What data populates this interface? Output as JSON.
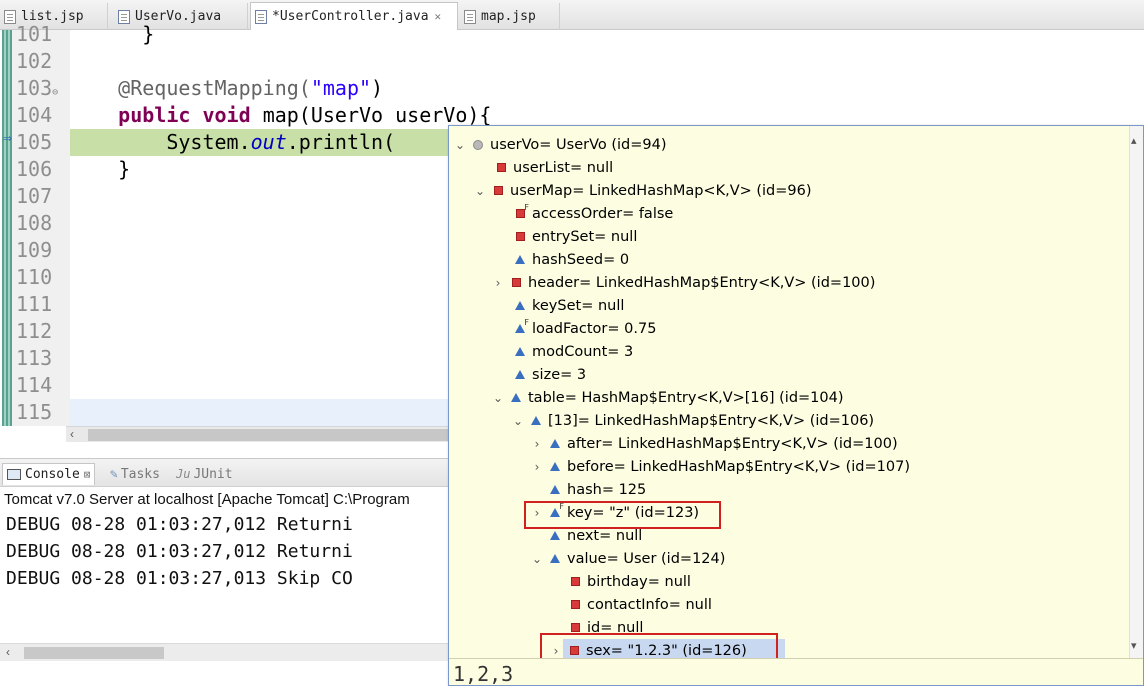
{
  "editor_tabs": [
    {
      "label": "list.jsp",
      "icon": "jsp-file-icon",
      "active": false
    },
    {
      "label": "UserVo.java",
      "icon": "java-file-icon",
      "active": false
    },
    {
      "label": "*UserController.java",
      "icon": "java-file-icon",
      "active": true,
      "close": "✕"
    },
    {
      "label": "map.jsp",
      "icon": "jsp-file-icon",
      "active": false
    }
  ],
  "editor": {
    "line_numbers": [
      "101",
      "102",
      "103",
      "104",
      "105",
      "106",
      "107",
      "108",
      "109",
      "110",
      "111",
      "112",
      "113",
      "114",
      "115"
    ],
    "code": {
      "l101": "}",
      "l103_annotation": "@RequestMapping(",
      "l103_string": "\"map\"",
      "l103_close": ")",
      "l104_kw1": "public",
      "l104_kw2": "void",
      "l104_rest": "map(UserVo userVo){",
      "l105_a": "System.",
      "l105_field": "out",
      "l105_b": ".println(",
      "l106": "}"
    }
  },
  "console": {
    "tabs": [
      {
        "label": "Console",
        "active": true
      },
      {
        "label": "Tasks",
        "active": false
      },
      {
        "label": "JUnit",
        "prefix": "Ju",
        "active": false
      }
    ],
    "description": "Tomcat v7.0 Server at localhost [Apache Tomcat] C:\\Program",
    "lines": [
      "DEBUG 08-28 01:03:27,012 Returni",
      "DEBUG 08-28 01:03:27,012 Returni",
      "DEBUG 08-28 01:03:27,013 Skip CO"
    ]
  },
  "debug_popup": {
    "tree": [
      {
        "text": "userVo= UserVo  (id=94)",
        "expander": "⌄",
        "icon": "circle"
      },
      {
        "text": "userList= null",
        "expander": "",
        "icon": "square"
      },
      {
        "text": "userMap= LinkedHashMap<K,V>  (id=96)",
        "expander": "⌄",
        "icon": "square"
      },
      {
        "text": "accessOrder= false",
        "expander": "",
        "icon": "square-final"
      },
      {
        "text": "entrySet= null",
        "expander": "",
        "icon": "square"
      },
      {
        "text": "hashSeed= 0",
        "expander": "",
        "icon": "triangle"
      },
      {
        "text": "header= LinkedHashMap$Entry<K,V>  (id=100)",
        "expander": "›",
        "icon": "square"
      },
      {
        "text": "keySet= null",
        "expander": "",
        "icon": "triangle"
      },
      {
        "text": "loadFactor= 0.75",
        "expander": "",
        "icon": "triangle-final"
      },
      {
        "text": "modCount= 3",
        "expander": "",
        "icon": "triangle"
      },
      {
        "text": "size= 3",
        "expander": "",
        "icon": "triangle"
      },
      {
        "text": "table= HashMap$Entry<K,V>[16]  (id=104)",
        "expander": "⌄",
        "icon": "triangle"
      },
      {
        "text": "[13]= LinkedHashMap$Entry<K,V>  (id=106)",
        "expander": "⌄",
        "icon": "triangle"
      },
      {
        "text": "after= LinkedHashMap$Entry<K,V>  (id=100)",
        "expander": "›",
        "icon": "triangle"
      },
      {
        "text": "before= LinkedHashMap$Entry<K,V>  (id=107)",
        "expander": "›",
        "icon": "triangle"
      },
      {
        "text": "hash= 125",
        "expander": "",
        "icon": "triangle"
      },
      {
        "text": "key= \"z\" (id=123)",
        "expander": "›",
        "icon": "triangle-final"
      },
      {
        "text": "next= null",
        "expander": "",
        "icon": "triangle"
      },
      {
        "text": "value= User  (id=124)",
        "expander": "⌄",
        "icon": "triangle"
      },
      {
        "text": "birthday= null",
        "expander": "",
        "icon": "square"
      },
      {
        "text": "contactInfo= null",
        "expander": "",
        "icon": "square"
      },
      {
        "text": "id= null",
        "expander": "",
        "icon": "square"
      },
      {
        "text": "sex= \"1.2.3\" (id=126)",
        "expander": "›",
        "icon": "square"
      }
    ],
    "detail_value": "1,2,3"
  },
  "colors": {
    "highlight_line": "#c8e0a8",
    "popup_background": "#fdfde2",
    "annotation_box": "#d02020"
  }
}
